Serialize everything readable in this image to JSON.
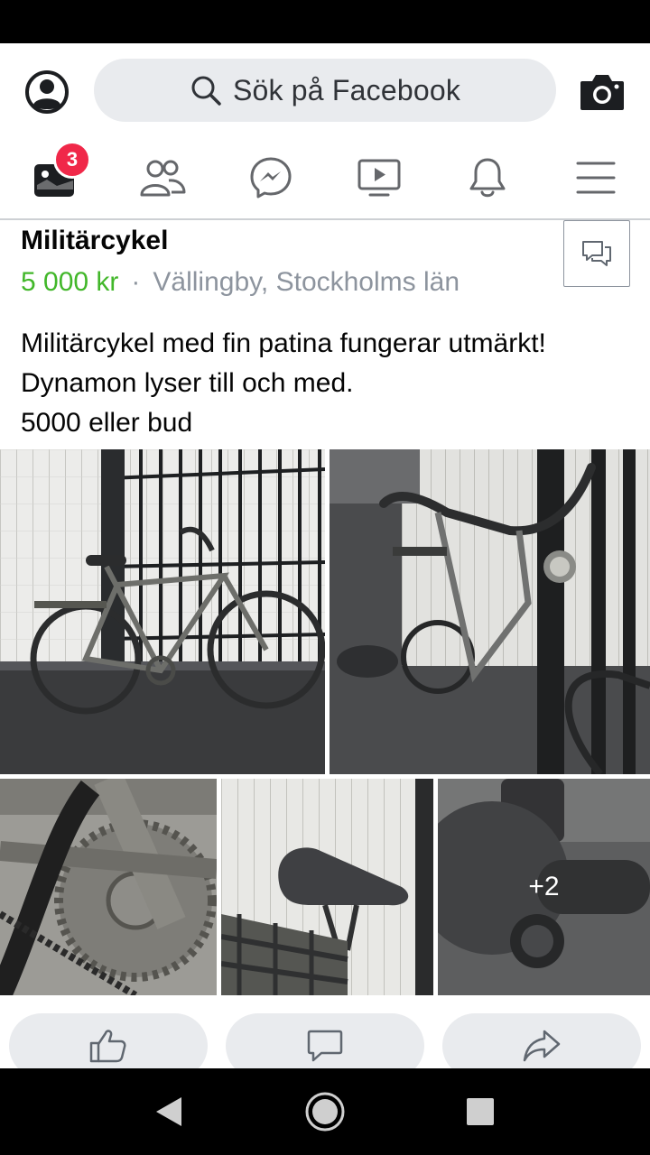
{
  "header": {
    "search_placeholder": "Sök på Facebook",
    "icons": {
      "profile": "profile-icon",
      "search": "search-icon",
      "camera": "camera-icon"
    }
  },
  "nav": {
    "items": [
      {
        "name": "marketplace",
        "icon": "marketplace-icon",
        "badge": "3",
        "active": true
      },
      {
        "name": "friends",
        "icon": "friends-icon"
      },
      {
        "name": "messenger",
        "icon": "messenger-icon"
      },
      {
        "name": "watch",
        "icon": "video-icon"
      },
      {
        "name": "notifications",
        "icon": "bell-icon"
      },
      {
        "name": "menu",
        "icon": "hamburger-icon"
      }
    ]
  },
  "listing": {
    "title": "Militärcykel",
    "price": "5 000 kr",
    "separator": "·",
    "location": "Vällingby, Stockholms län",
    "description_lines": [
      "Militärcykel med fin patina fungerar utmärkt!",
      "Dynamon lyser till och med.",
      "5000 eller bud"
    ],
    "photos": [
      {
        "subject": "bicycle side view"
      },
      {
        "subject": "bicycle front view"
      },
      {
        "subject": "chainring close-up"
      },
      {
        "subject": "saddle close-up"
      },
      {
        "subject": "lamp close-up",
        "more_label": "+2"
      }
    ]
  },
  "actions": [
    {
      "name": "like",
      "icon": "thumbs-up-icon"
    },
    {
      "name": "comment",
      "icon": "comment-icon"
    },
    {
      "name": "share",
      "icon": "share-icon"
    }
  ],
  "colors": {
    "price": "#42b72a",
    "badge": "#f02849",
    "secondary_text": "#8d949e",
    "pill_bg": "#e9ebee"
  }
}
